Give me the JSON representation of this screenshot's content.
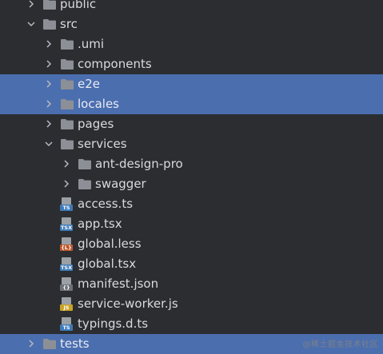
{
  "tree": {
    "items": [
      {
        "label": "public",
        "type": "folder",
        "level": 0,
        "expanded": false,
        "selected": false
      },
      {
        "label": "src",
        "type": "folder",
        "level": 0,
        "expanded": true,
        "selected": false
      },
      {
        "label": ".umi",
        "type": "folder",
        "level": 1,
        "expanded": false,
        "selected": false
      },
      {
        "label": "components",
        "type": "folder",
        "level": 1,
        "expanded": false,
        "selected": false
      },
      {
        "label": "e2e",
        "type": "folder",
        "level": 1,
        "expanded": false,
        "selected": true
      },
      {
        "label": "locales",
        "type": "folder",
        "level": 1,
        "expanded": false,
        "selected": true
      },
      {
        "label": "pages",
        "type": "folder",
        "level": 1,
        "expanded": false,
        "selected": false
      },
      {
        "label": "services",
        "type": "folder",
        "level": 1,
        "expanded": true,
        "selected": false
      },
      {
        "label": "ant-design-pro",
        "type": "folder",
        "level": 2,
        "expanded": false,
        "selected": false
      },
      {
        "label": "swagger",
        "type": "folder",
        "level": 2,
        "expanded": false,
        "selected": false
      },
      {
        "label": "access.ts",
        "type": "file",
        "badge": "TS",
        "level": 1,
        "selected": false
      },
      {
        "label": "app.tsx",
        "type": "file",
        "badge": "TSX",
        "level": 1,
        "selected": false
      },
      {
        "label": "global.less",
        "type": "file",
        "badge": "{L}",
        "level": 1,
        "selected": false
      },
      {
        "label": "global.tsx",
        "type": "file",
        "badge": "TSX",
        "level": 1,
        "selected": false
      },
      {
        "label": "manifest.json",
        "type": "file",
        "badge": "{}",
        "level": 1,
        "selected": false
      },
      {
        "label": "service-worker.js",
        "type": "file",
        "badge": "JS",
        "level": 1,
        "selected": false
      },
      {
        "label": "typings.d.ts",
        "type": "file",
        "badge": "TS",
        "level": 1,
        "selected": false
      },
      {
        "label": "tests",
        "type": "folder",
        "level": 0,
        "expanded": false,
        "selected": true
      }
    ]
  },
  "watermark": "@稀土掘金技术社区",
  "colors": {
    "background": "#2b2d30",
    "selection": "#4b6eaf",
    "folder": "#8c9096",
    "ts_badge": "#3d7ab8",
    "js_badge": "#c9a227",
    "less_badge": "#c0582e",
    "json_badge": "#6d7178"
  }
}
